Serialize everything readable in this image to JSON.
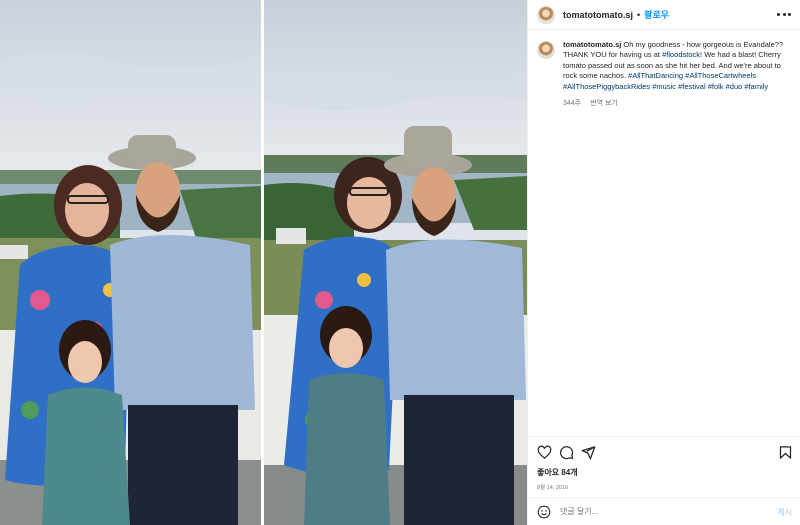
{
  "post": {
    "username": "tomatotomato.sj",
    "separator": "•",
    "follow_label": "팔로우",
    "more_icon": "more-horizontal-icon"
  },
  "caption": {
    "username": "tomatotomato.sj",
    "text_1": " Oh my goodness - how gorgeous is Evandale?? THANK YOU for having us at ",
    "tag_floodstock": "#floodstock",
    "text_2": "! We had a blast! Cherry tomato passed out as soon as she hit her bed. And we're about to rock some nachos. ",
    "tag_1": "#AllThatDancing",
    "tag_2": "#AllThoseCartwheels",
    "tag_3": "#AllThosePiggybackRides",
    "tag_4": "#music",
    "tag_5": "#festival",
    "tag_6": "#folk",
    "tag_7": "#duo",
    "tag_8": "#family",
    "age": "344주",
    "translate": "번역 보기"
  },
  "actions": {
    "icons": [
      "heart-icon",
      "comment-icon",
      "share-icon",
      "bookmark-icon"
    ],
    "likes": "좋아요 84개",
    "date": "8월 14, 2016"
  },
  "add_comment": {
    "placeholder": "댓글 달기...",
    "post_label": "게시"
  },
  "colors": {
    "accent": "#0095f6",
    "hashtag": "#00376b",
    "muted": "#737373",
    "post_disabled": "#b3dbff"
  }
}
